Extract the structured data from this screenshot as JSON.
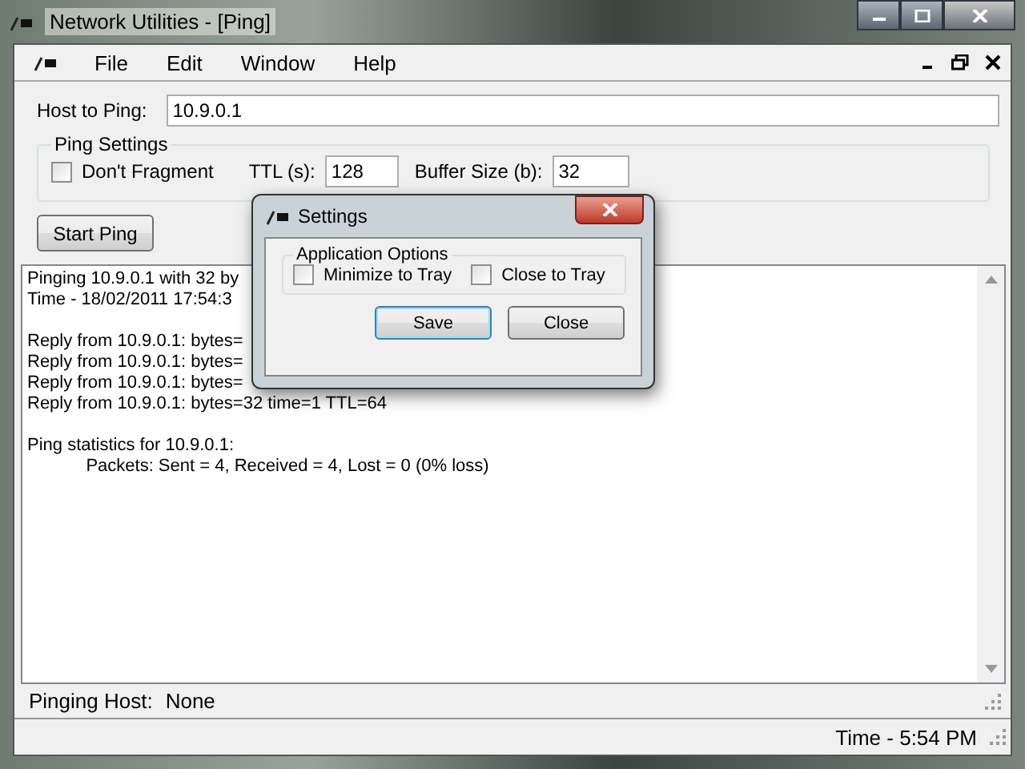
{
  "window": {
    "title": "Network Utilities - [Ping]"
  },
  "menu": [
    "File",
    "Edit",
    "Window",
    "Help"
  ],
  "host": {
    "label": "Host to Ping:",
    "value": "10.9.0.1"
  },
  "ping_settings": {
    "title": "Ping Settings",
    "dont_fragment": {
      "label": "Don't Fragment",
      "checked": false
    },
    "ttl": {
      "label": "TTL (s):",
      "value": "128"
    },
    "buffer": {
      "label": "Buffer Size (b):",
      "value": "32"
    }
  },
  "start_button": "Start Ping",
  "output_blocks": [
    [
      "Pinging 10.9.0.1 with 32 by",
      "Time - 18/02/2011 17:54:3"
    ],
    [
      "Reply from 10.9.0.1: bytes=",
      "Reply from 10.9.0.1: bytes=",
      "Reply from 10.9.0.1: bytes=",
      "Reply from 10.9.0.1: bytes=32 time=1 TTL=64"
    ],
    [
      "Ping statistics for 10.9.0.1:",
      "\tPackets: Sent = 4, Received = 4, Lost = 0 (0% loss)"
    ]
  ],
  "inner_status": {
    "label": "Pinging Host:",
    "value": "None"
  },
  "status_bar": "Time - 5:54 PM",
  "dialog": {
    "title": "Settings",
    "group": "Application Options",
    "options": [
      {
        "label": "Minimize to Tray",
        "checked": false
      },
      {
        "label": "Close to Tray",
        "checked": false
      }
    ],
    "buttons": [
      {
        "label": "Save",
        "default": true
      },
      {
        "label": "Close",
        "default": false
      }
    ]
  }
}
